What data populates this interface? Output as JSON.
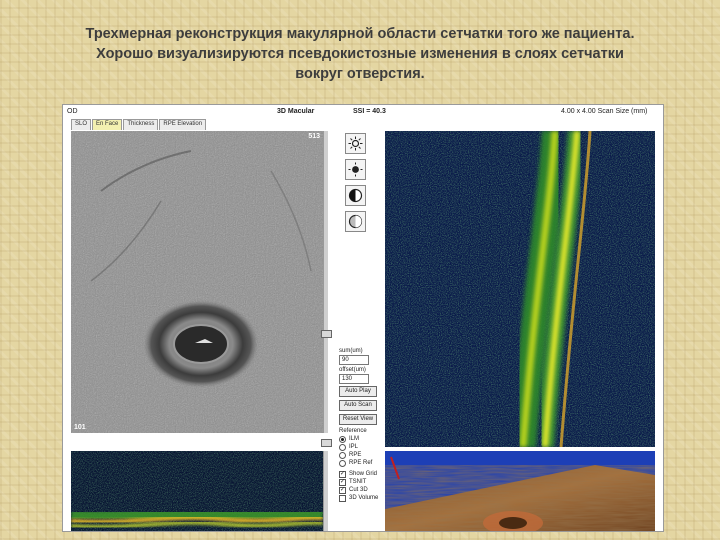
{
  "caption": {
    "line1": "Трехмерная реконструкция макулярной области сетчатки того же пациента.",
    "line2": "Хорошо визуализируются псевдокистозные изменения в слоях сетчатки",
    "line3": "вокруг отверстия."
  },
  "app": {
    "eye": "OD",
    "title": "3D Macular",
    "ssi": "SSI = 40.3",
    "scan_size": "4.00 x 4.00 Scan Size (mm)",
    "tabs": [
      {
        "label": "SLO",
        "active": false
      },
      {
        "label": "En Face",
        "active": true
      },
      {
        "label": "Thickness",
        "active": false
      },
      {
        "label": "RPE Elevation",
        "active": false
      }
    ],
    "enface": {
      "top_right": "513",
      "bottom_left": "101"
    },
    "tools": [
      {
        "icon": "brightness-up-icon"
      },
      {
        "icon": "brightness-down-icon"
      },
      {
        "icon": "contrast-icon"
      },
      {
        "icon": "invert-icon"
      }
    ],
    "controls": {
      "sum_label": "sum(um)",
      "sum_value": "90",
      "offset_label": "offset(um)",
      "offset_value": "130",
      "auto_play": "Auto Play",
      "auto_scan": "Auto Scan",
      "reset_view": "Reset View",
      "reference_label": "Reference",
      "reference_options": [
        {
          "label": "ILM",
          "selected": true
        },
        {
          "label": "IPL",
          "selected": false
        },
        {
          "label": "RPE",
          "selected": false
        },
        {
          "label": "RPE Ref",
          "selected": false
        }
      ],
      "checkboxes": [
        {
          "label": "Show Grid",
          "checked": true
        },
        {
          "label": "TSNIT",
          "checked": true
        },
        {
          "label": "Cut 3D",
          "checked": true
        },
        {
          "label": "3D Volume",
          "checked": false
        }
      ]
    }
  }
}
